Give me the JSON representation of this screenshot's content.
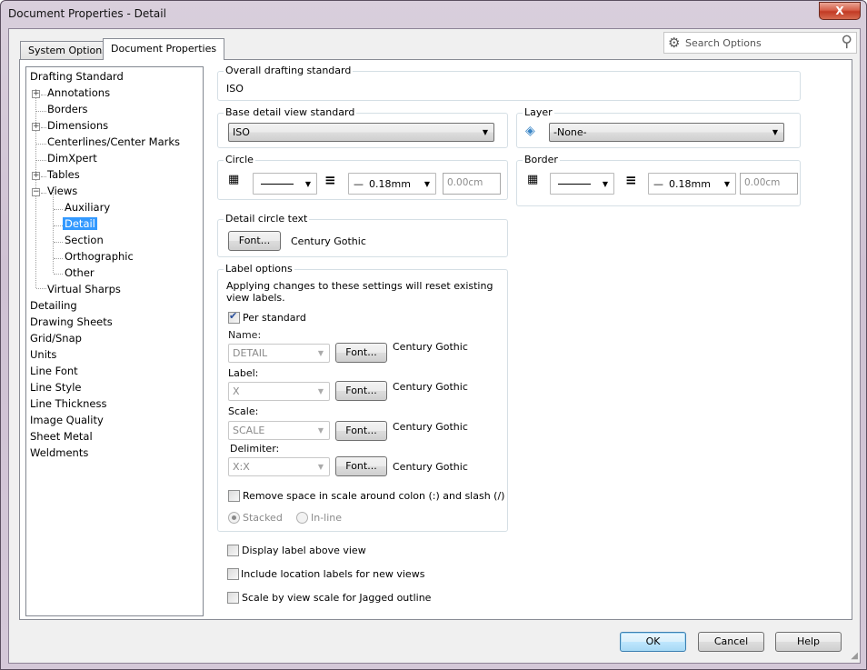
{
  "window": {
    "title": "Document Properties - Detail",
    "close_label": "X"
  },
  "tabs": [
    {
      "label": "System Options",
      "active": false
    },
    {
      "label": "Document Properties",
      "active": true
    }
  ],
  "search": {
    "placeholder": "Search Options",
    "gear_icon": "gear-icon",
    "search_icon": "magnifier-icon"
  },
  "tree": {
    "items": [
      {
        "label": "Drafting Standard",
        "level": 0
      },
      {
        "label": "Annotations",
        "level": 1,
        "expander": "+"
      },
      {
        "label": "Borders",
        "level": 1
      },
      {
        "label": "Dimensions",
        "level": 1,
        "expander": "+"
      },
      {
        "label": "Centerlines/Center Marks",
        "level": 1
      },
      {
        "label": "DimXpert",
        "level": 1
      },
      {
        "label": "Tables",
        "level": 1,
        "expander": "+"
      },
      {
        "label": "Views",
        "level": 1,
        "expander": "-"
      },
      {
        "label": "Auxiliary",
        "level": 2
      },
      {
        "label": "Detail",
        "level": 2,
        "selected": true
      },
      {
        "label": "Section",
        "level": 2
      },
      {
        "label": "Orthographic",
        "level": 2
      },
      {
        "label": "Other",
        "level": 2
      },
      {
        "label": "Virtual Sharps",
        "level": 1
      },
      {
        "label": "Detailing",
        "level": 0
      },
      {
        "label": "Drawing Sheets",
        "level": 0
      },
      {
        "label": "Grid/Snap",
        "level": 0
      },
      {
        "label": "Units",
        "level": 0
      },
      {
        "label": "Line Font",
        "level": 0
      },
      {
        "label": "Line Style",
        "level": 0
      },
      {
        "label": "Line Thickness",
        "level": 0
      },
      {
        "label": "Image Quality",
        "level": 0
      },
      {
        "label": "Sheet Metal",
        "level": 0
      },
      {
        "label": "Weldments",
        "level": 0
      }
    ]
  },
  "overall": {
    "title": "Overall drafting standard",
    "value": "ISO"
  },
  "base_detail": {
    "title": "Base detail view standard",
    "selected": "ISO"
  },
  "layer": {
    "title": "Layer",
    "selected": "-None-"
  },
  "circle": {
    "title": "Circle",
    "line_weight": "0.18mm",
    "custom_thickness": "0.00cm"
  },
  "border": {
    "title": "Border",
    "line_weight": "0.18mm",
    "custom_thickness": "0.00cm"
  },
  "detail_circle_text": {
    "title": "Detail circle text",
    "font_button": "Font...",
    "font_name": "Century Gothic"
  },
  "label_options": {
    "title": "Label options",
    "note": "Applying changes to these settings will reset existing view labels.",
    "per_standard": {
      "label": "Per standard",
      "checked": true
    },
    "rows": [
      {
        "caption": "Name:",
        "value": "DETAIL",
        "font_button": "Font...",
        "font_name": "Century Gothic"
      },
      {
        "caption": "Label:",
        "value": "X",
        "font_button": "Font...",
        "font_name": "Century Gothic"
      },
      {
        "caption": "Scale:",
        "value": "SCALE",
        "font_button": "Font...",
        "font_name": "Century Gothic"
      },
      {
        "caption": "Delimiter:",
        "value": "X:X",
        "font_button": "Font...",
        "font_name": "Century Gothic"
      }
    ],
    "remove_space": {
      "label": "Remove space in scale around colon (:) and slash (/)",
      "checked": false
    },
    "stacked": {
      "label": "Stacked",
      "selected": true
    },
    "inline": {
      "label": "In-line",
      "selected": false
    }
  },
  "options": [
    {
      "label": "Display label above view",
      "checked": false
    },
    {
      "label": "Include location labels for new views",
      "checked": false
    },
    {
      "label": "Scale by view scale for Jagged outline",
      "checked": false
    }
  ],
  "footer": {
    "ok": "OK",
    "cancel": "Cancel",
    "help": "Help"
  }
}
